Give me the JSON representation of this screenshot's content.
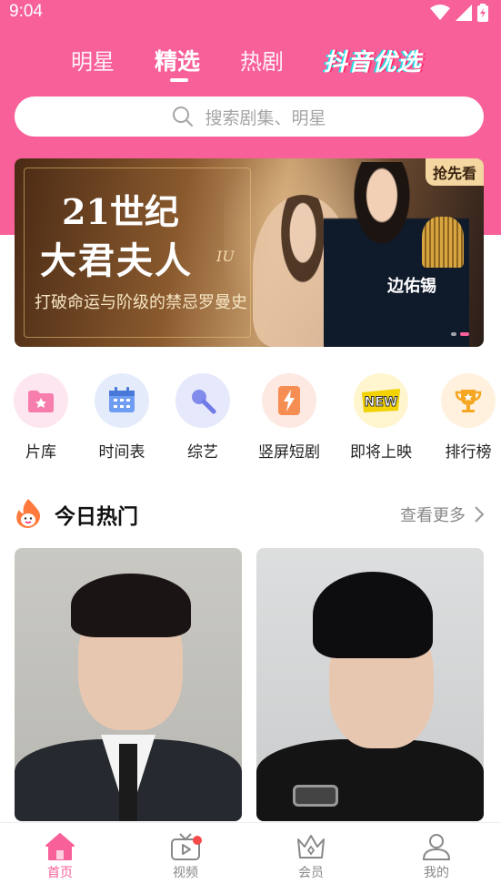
{
  "status_bar": {
    "time": "9:04"
  },
  "top_tabs": {
    "items": [
      {
        "label": "明星"
      },
      {
        "label": "精选"
      },
      {
        "label": "热剧"
      }
    ],
    "active": "精选",
    "brand_label": "抖音优选"
  },
  "search": {
    "placeholder": "搜索剧集、明星"
  },
  "banner": {
    "title_line1": "21世纪",
    "title_line2": "大君夫人",
    "iu": "IU",
    "subtitle": "打破命运与阶级的禁忌罗曼史",
    "actor": "边佑锡",
    "badge": "抢先看"
  },
  "categories": [
    {
      "label": "片库",
      "icon": "folder-star-icon",
      "bg": "#fde6ef",
      "color": "#f5639b"
    },
    {
      "label": "时间表",
      "icon": "calendar-icon",
      "bg": "#e4ecfb",
      "color": "#5b8ff0"
    },
    {
      "label": "综艺",
      "icon": "microphone-icon",
      "bg": "#e6e8fb",
      "color": "#6f7ae8"
    },
    {
      "label": "竖屏短剧",
      "icon": "lightning-phone-icon",
      "bg": "#fde9e2",
      "color": "#f57c3a"
    },
    {
      "label": "即将上映",
      "icon": "new-badge-icon",
      "bg": "#fff5cf",
      "color": "#f2c400"
    },
    {
      "label": "排行榜",
      "icon": "trophy-icon",
      "bg": "#fff1dd",
      "color": "#f5a623"
    }
  ],
  "section": {
    "title": "今日热门",
    "more": "查看更多"
  },
  "bottom_nav": [
    {
      "label": "首页",
      "icon": "home-icon",
      "active": true
    },
    {
      "label": "视频",
      "icon": "tv-icon",
      "active": false
    },
    {
      "label": "会员",
      "icon": "crown-icon",
      "active": false
    },
    {
      "label": "我的",
      "icon": "profile-icon",
      "active": false
    }
  ],
  "colors": {
    "brand_pink": "#f8609a",
    "notification_red": "#f64a4a"
  }
}
